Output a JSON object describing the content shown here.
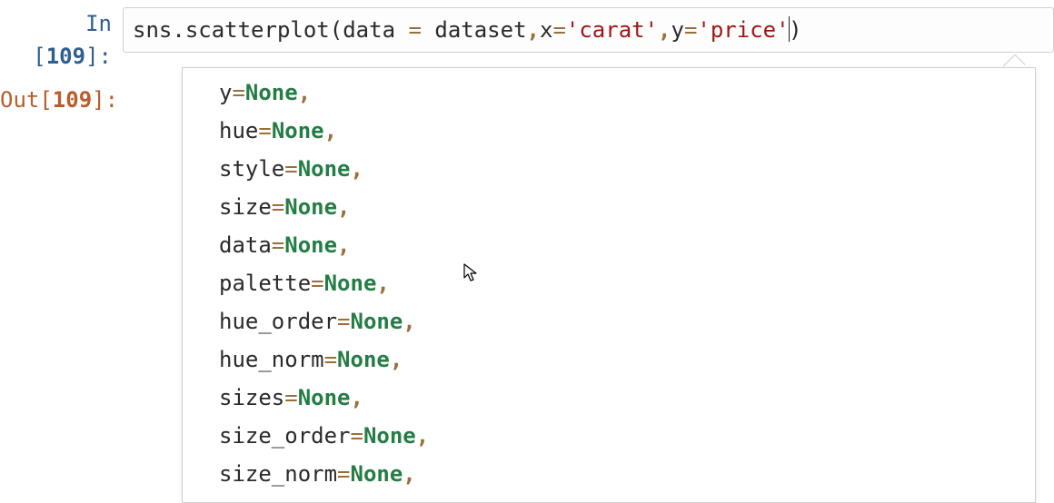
{
  "cell": {
    "in_prompt_prefix": "In [",
    "in_prompt_num": "109",
    "in_prompt_suffix": "]:",
    "out_prompt_prefix": "Out[",
    "out_prompt_num": "109",
    "out_prompt_suffix": "]:"
  },
  "code": {
    "obj": "sns",
    "dot": ".",
    "func": "scatterplot",
    "open": "(",
    "kw_data": "data",
    "space": " ",
    "eq": "=",
    "val_data": "dataset",
    "comma1": ",",
    "kw_x": "x",
    "val_x": "'carat'",
    "comma2": ",",
    "kw_y": "y",
    "val_y": "'price'",
    "close": ")"
  },
  "tooltip_params": [
    {
      "name": "y",
      "default": "None"
    },
    {
      "name": "hue",
      "default": "None"
    },
    {
      "name": "style",
      "default": "None"
    },
    {
      "name": "size",
      "default": "None"
    },
    {
      "name": "data",
      "default": "None"
    },
    {
      "name": "palette",
      "default": "None"
    },
    {
      "name": "hue_order",
      "default": "None"
    },
    {
      "name": "hue_norm",
      "default": "None"
    },
    {
      "name": "sizes",
      "default": "None"
    },
    {
      "name": "size_order",
      "default": "None"
    },
    {
      "name": "size_norm",
      "default": "None"
    }
  ]
}
